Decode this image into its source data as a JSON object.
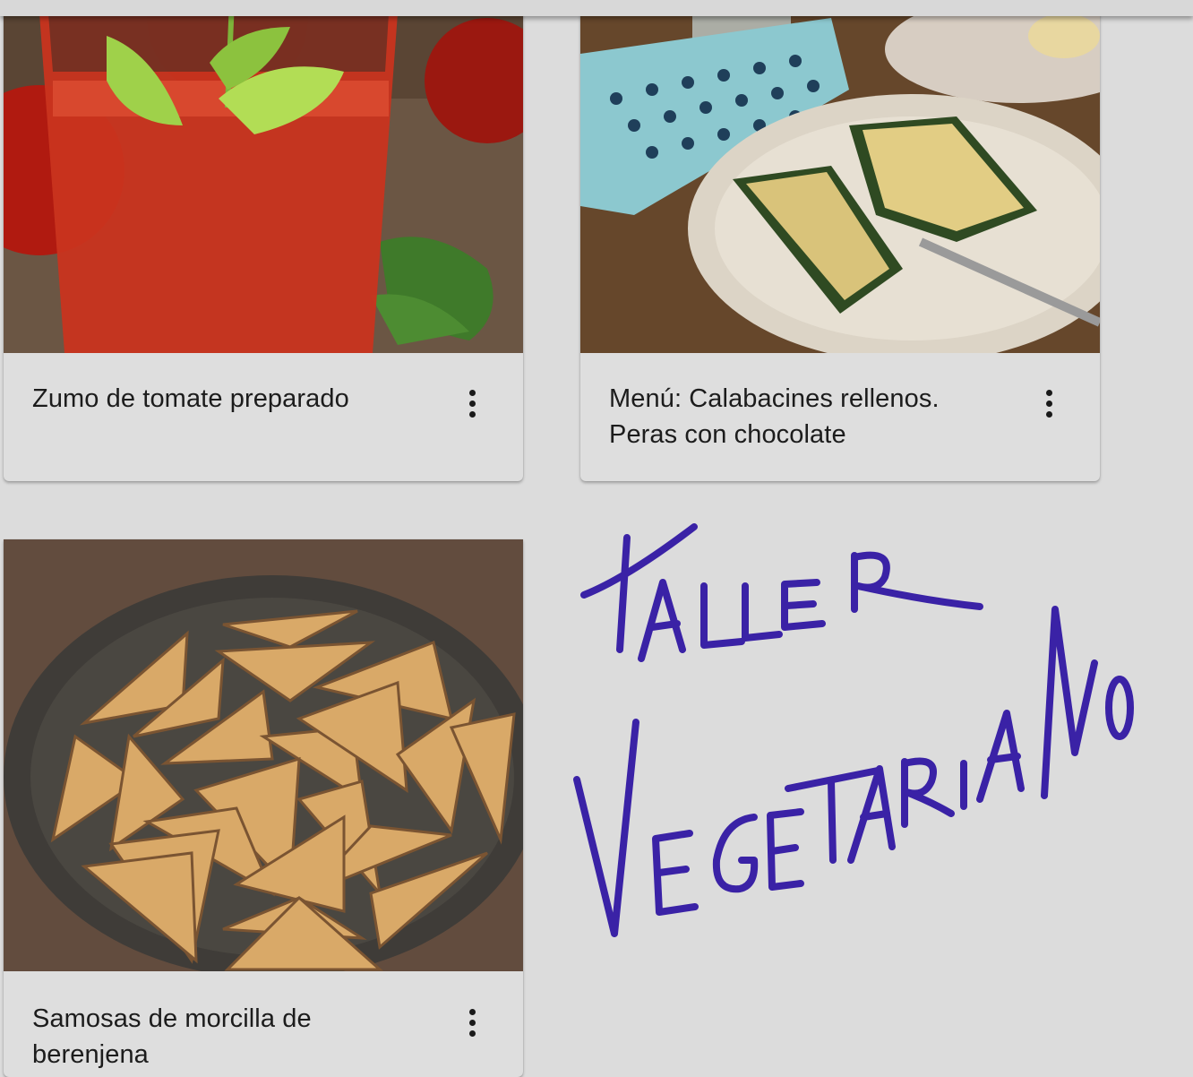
{
  "recipes": [
    {
      "title": "Zumo de tomate preparado",
      "menu_icon": "more-vert-icon"
    },
    {
      "title": "Menú: Calabacines rellenos. Peras con chocolate",
      "menu_icon": "more-vert-icon"
    },
    {
      "title": "Samosas de morcilla de berenjena",
      "menu_icon": "more-vert-icon"
    }
  ],
  "annotation": {
    "text": "TALLER VEGETARIANO",
    "color": "#3a22a6"
  },
  "colors": {
    "background": "#dcdcdc",
    "card": "#dedede",
    "text": "#1c1c1c"
  }
}
